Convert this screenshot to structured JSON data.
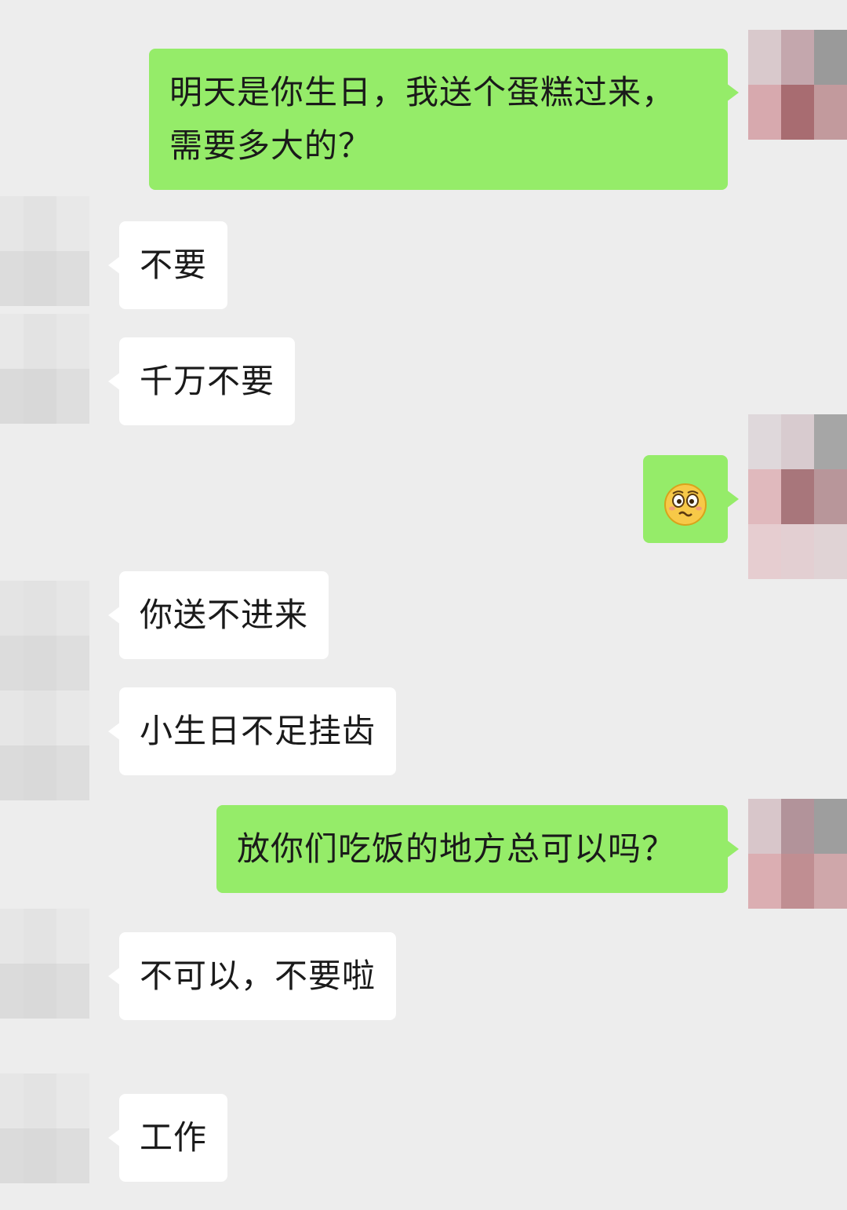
{
  "messages": [
    {
      "side": "sent",
      "text": "明天是你生日，我送个蛋糕过来，需要多大的？"
    },
    {
      "side": "recv",
      "text": "不要"
    },
    {
      "side": "recv",
      "text": "千万不要"
    },
    {
      "side": "sent",
      "emoji": "flushed-face-icon"
    },
    {
      "side": "recv",
      "text": "你送不进来"
    },
    {
      "side": "recv",
      "text": "小生日不足挂齿"
    },
    {
      "side": "sent",
      "text": "放你们吃饭的地方总可以吗？"
    },
    {
      "side": "recv",
      "text": "不可以，不要啦"
    },
    {
      "side": "recv",
      "text": "工作"
    }
  ],
  "colors": {
    "background": "#ededed",
    "sent_bubble": "#95ec69",
    "received_bubble": "#ffffff"
  }
}
